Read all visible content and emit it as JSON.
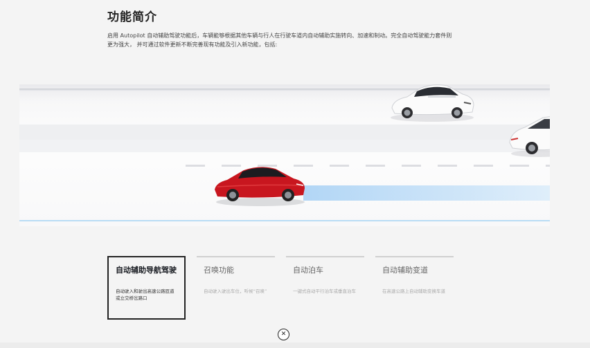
{
  "intro": {
    "title": "功能简介",
    "description": "启用 Autopilot 自动辅助驾驶功能后，车辆能够根据其他车辆与行人在行驶车道内自动辅助实施转向、加速和制动。完全自动驾驶能力套件则更为强大， 并可通过软件更新不断完善现有功能及引入新功能，包括:"
  },
  "features": [
    {
      "title": "自动辅助导航驾驶",
      "description": "自动驶入和驶出高速公路匝道或立交桥岔路口",
      "active": true
    },
    {
      "title": "召唤功能",
      "description": "自动驶入驶出车位，听候“召唤”",
      "active": false
    },
    {
      "title": "自动泊车",
      "description": "一键式自动平行泊车或垂直泊车",
      "active": false
    },
    {
      "title": "自动辅助变道",
      "description": "在高速公路上自动辅助变换车道",
      "active": false
    }
  ],
  "close": {
    "icon": "close-icon",
    "symbol": "✕"
  },
  "colors": {
    "red_car": "#c8161f",
    "white_car": "#ffffff",
    "lane_highlight": "#aad2f5",
    "text": "#171a20"
  }
}
